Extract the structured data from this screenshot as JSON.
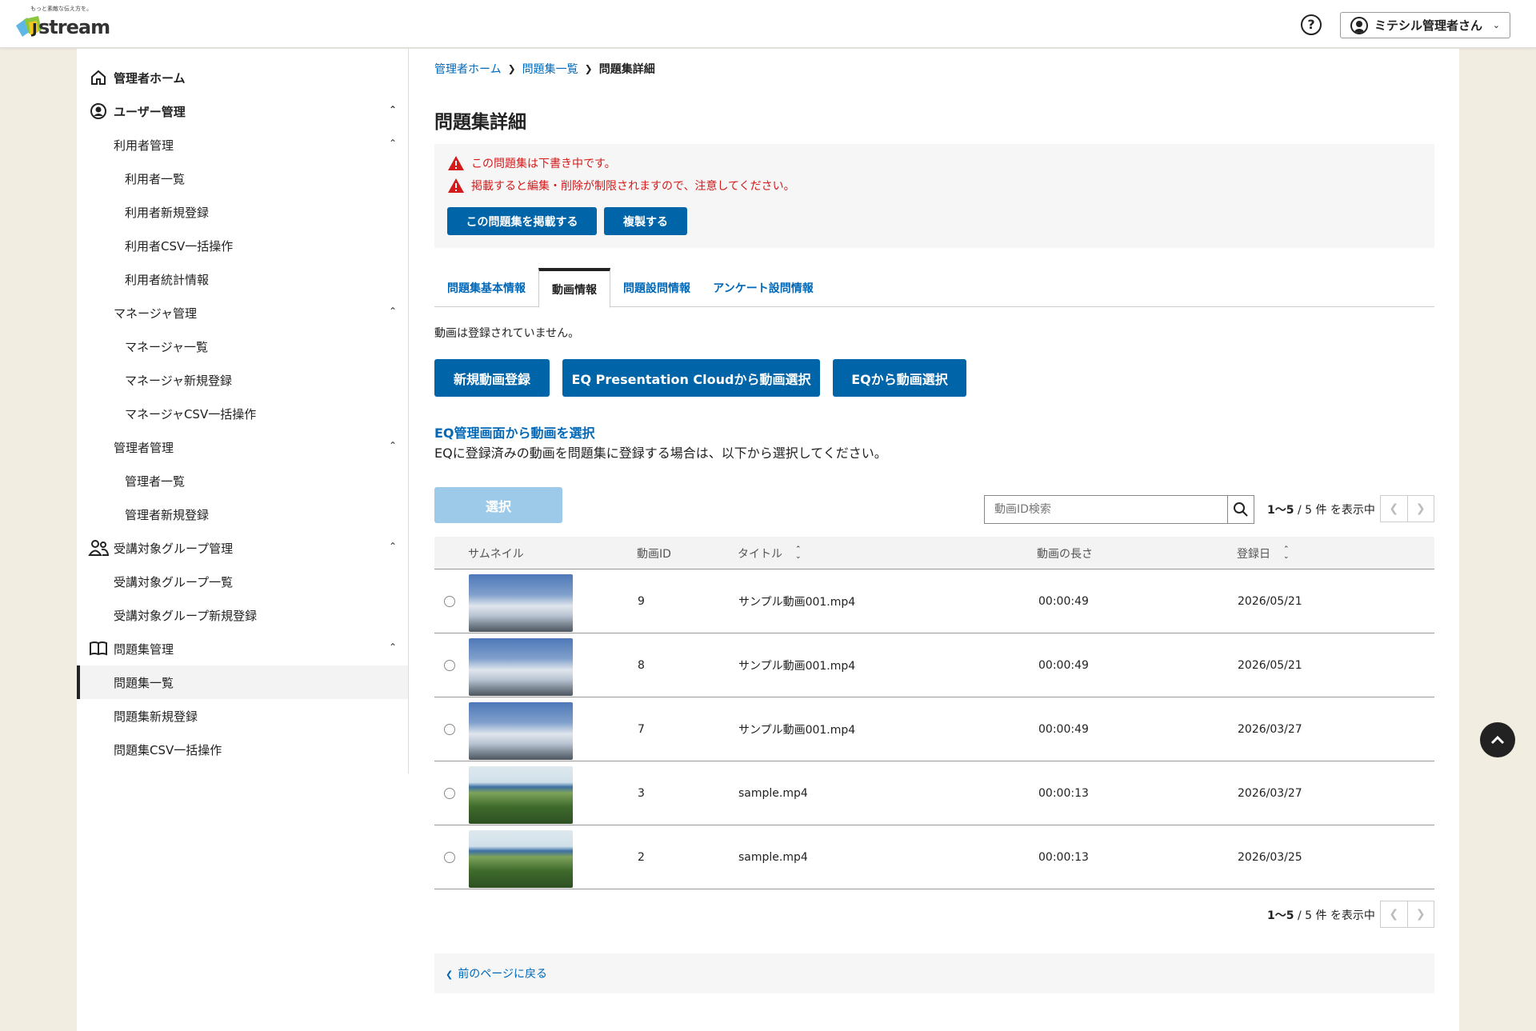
{
  "header": {
    "tagline": "もっと素敵な伝え方を。",
    "logo_text": "stream",
    "logo_letter": "J",
    "user_name": "ミテシル管理者さん",
    "help_label": "?"
  },
  "sidebar": {
    "items": [
      {
        "label": "管理者ホーム",
        "level": 1,
        "icon": "home-icon"
      },
      {
        "label": "ユーザー管理",
        "level": 1,
        "icon": "user-circle-icon",
        "expanded": true
      },
      {
        "label": "利用者管理",
        "level": 2,
        "expanded": true
      },
      {
        "label": "利用者一覧",
        "level": 3
      },
      {
        "label": "利用者新規登録",
        "level": 3
      },
      {
        "label": "利用者CSV一括操作",
        "level": 3
      },
      {
        "label": "利用者統計情報",
        "level": 3
      },
      {
        "label": "マネージャ管理",
        "level": 2,
        "expanded": true
      },
      {
        "label": "マネージャ一覧",
        "level": 3
      },
      {
        "label": "マネージャ新規登録",
        "level": 3
      },
      {
        "label": "マネージャCSV一括操作",
        "level": 3
      },
      {
        "label": "管理者管理",
        "level": 2,
        "expanded": true
      },
      {
        "label": "管理者一覧",
        "level": 3
      },
      {
        "label": "管理者新規登録",
        "level": 3
      },
      {
        "label": "受講対象グループ管理",
        "level": 1,
        "icon": "group-icon",
        "expanded": true
      },
      {
        "label": "受講対象グループ一覧",
        "level": 2
      },
      {
        "label": "受講対象グループ新規登録",
        "level": 2
      },
      {
        "label": "問題集管理",
        "level": 1,
        "icon": "book-icon",
        "expanded": true
      },
      {
        "label": "問題集一覧",
        "level": 2,
        "active": true
      },
      {
        "label": "問題集新規登録",
        "level": 2
      },
      {
        "label": "問題集CSV一括操作",
        "level": 2
      }
    ]
  },
  "breadcrumb": {
    "home": "管理者ホーム",
    "list": "問題集一覧",
    "current": "問題集詳細"
  },
  "page": {
    "title": "問題集詳細",
    "alert_1": "この問題集は下書き中です。",
    "alert_2": "掲載すると編集・削除が制限されますので、注意してください。",
    "publish_button": "この問題集を掲載する",
    "copy_button": "複製する"
  },
  "tabs": [
    "問題集基本情報",
    "動画情報",
    "問題設問情報",
    "アンケート設問情報"
  ],
  "active_tab": "動画情報",
  "video": {
    "no_video": "動画は登録されていません。",
    "new_button": "新規動画登録",
    "eqpc_button": "EQ Presentation Cloudから動画選択",
    "eq_button": "EQから動画選択",
    "section_title": "EQ管理画面から動画を選択",
    "section_desc": "EQに登録済みの動画を問題集に登録する場合は、以下から選択してください。",
    "select_button": "選択",
    "search_placeholder": "動画ID検索",
    "count_range": "1〜5",
    "count_rest": "/ 5 件 を表示中"
  },
  "table": {
    "headers": {
      "thumbnail": "サムネイル",
      "video_id": "動画ID",
      "title": "タイトル",
      "length": "動画の長さ",
      "date": "登録日"
    },
    "rows": [
      {
        "id": "9",
        "title": "サンプル動画001.mp4",
        "length": "00:00:49",
        "date": "2026/05/21",
        "thumb": "sky"
      },
      {
        "id": "8",
        "title": "サンプル動画001.mp4",
        "length": "00:00:49",
        "date": "2026/05/21",
        "thumb": "sky"
      },
      {
        "id": "7",
        "title": "サンプル動画001.mp4",
        "length": "00:00:49",
        "date": "2026/03/27",
        "thumb": "sky"
      },
      {
        "id": "3",
        "title": "sample.mp4",
        "length": "00:00:13",
        "date": "2026/03/27",
        "thumb": "garden"
      },
      {
        "id": "2",
        "title": "sample.mp4",
        "length": "00:00:13",
        "date": "2026/03/25",
        "thumb": "garden"
      }
    ]
  },
  "footer": {
    "back_link": "前のページに戻る"
  },
  "colors": {
    "primary": "#0064a8",
    "link": "#0068b7",
    "alert": "#d41a1a",
    "disabled": "#9ccae8"
  }
}
